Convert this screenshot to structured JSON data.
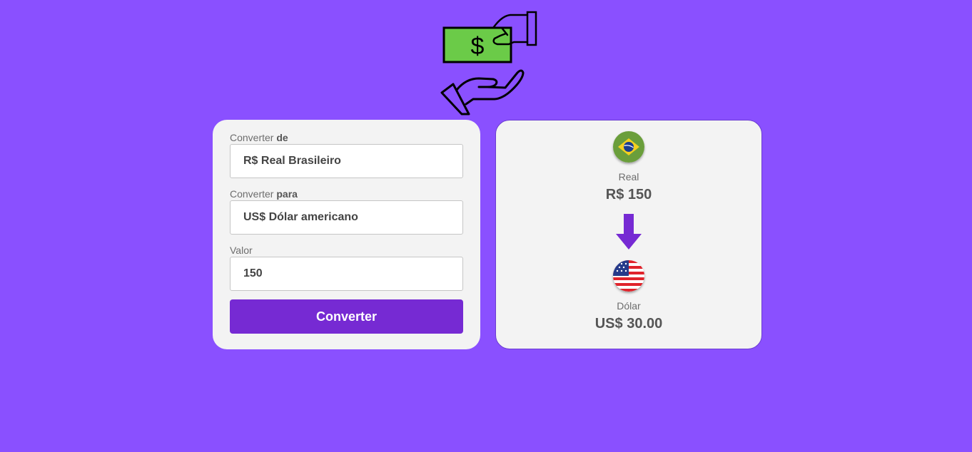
{
  "form": {
    "from_label_prefix": "Converter ",
    "from_label_bold": "de",
    "from_value": "R$ Real Brasileiro",
    "to_label_prefix": "Converter ",
    "to_label_bold": "para",
    "to_value": "US$ Dólar americano",
    "amount_label": "Valor",
    "amount_value": "150",
    "convert_button": "Converter"
  },
  "result": {
    "from_name": "Real",
    "from_value": "R$ 150",
    "to_name": "Dólar",
    "to_value": "US$ 30.00"
  },
  "icons": {
    "logo": "hand-giving-money-icon",
    "from_flag": "brazil-flag-icon",
    "arrow": "arrow-down-icon",
    "to_flag": "usa-flag-icon"
  },
  "colors": {
    "background": "#8a50ff",
    "accent": "#762ad3",
    "money": "#6bcb48"
  }
}
